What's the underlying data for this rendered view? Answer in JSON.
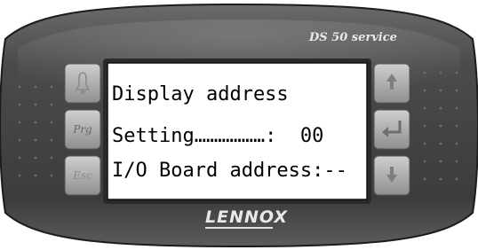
{
  "device": {
    "model_label": "DS 50 service",
    "brand_label": "LENNOX"
  },
  "screen": {
    "line1": "Display address",
    "line2": "Setting………………:  00",
    "line3": "I/O Board address:--"
  },
  "buttons": {
    "prg_label": "Prg",
    "esc_label": "Esc",
    "alarm_icon": "bell-icon",
    "up_icon": "arrow-up-icon",
    "enter_icon": "enter-icon",
    "down_icon": "arrow-down-icon"
  },
  "colors": {
    "bezel": "#4a4a4a",
    "screen": "#ffffff",
    "button": "#b5b5b5"
  }
}
